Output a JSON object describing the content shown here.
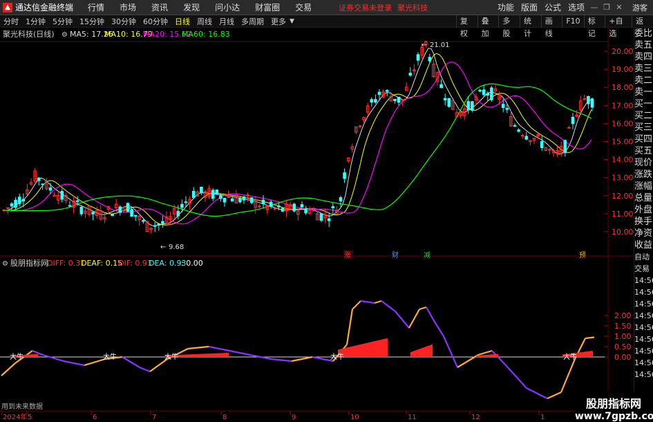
{
  "titlebar": {
    "app_title": "通达信金融终端",
    "menu": [
      "行情",
      "市场",
      "资讯",
      "发现",
      "问小达",
      "财富圈",
      "交易"
    ],
    "login_status": "证券交易未登录",
    "stock_name": "聚光科技",
    "right_menu": [
      "功能",
      "版面",
      "公式",
      "选项"
    ],
    "guest": "游客",
    "colors": {
      "bg": "#2a2a2a",
      "alert": "#e33"
    }
  },
  "toolbar": {
    "periods": [
      "分时",
      "1分钟",
      "5分钟",
      "15分钟",
      "30分钟",
      "60分钟",
      "日线",
      "周线",
      "月线",
      "多周期",
      "更多"
    ],
    "active_period": "日线",
    "right_buttons": [
      "复权",
      "叠加",
      "多股",
      "统计",
      "画线",
      "F10",
      "标记",
      "+自选",
      "返回"
    ]
  },
  "right_panel": {
    "items": [
      "委比",
      "卖五",
      "卖四",
      "卖三",
      "卖二",
      "卖一",
      "买一",
      "买二",
      "买三",
      "买四",
      "买五",
      "现价",
      "涨跌",
      "涨幅",
      "总量",
      "外盘",
      "换手",
      "净资",
      "收益",
      "自动",
      "交易",
      "14:56",
      "14:56",
      "14:56",
      "14:56",
      "14:56",
      "14:56",
      "14:56",
      "14:56",
      "14:56"
    ]
  },
  "price_panel": {
    "legend_title": "聚光科技(日线)",
    "ma_labels": [
      {
        "text": "MA5: 17.26",
        "color": "#dddddd"
      },
      {
        "text": "MA10: 16.79",
        "color": "#ffff00"
      },
      {
        "text": "MA20: 15.62",
        "color": "#ff00ff"
      },
      {
        "text": "MA60: 16.83",
        "color": "#00ff00"
      }
    ],
    "axis_ticks": [
      "20.00",
      "19.00",
      "18.00",
      "17.00",
      "16.00",
      "15.00",
      "14.00",
      "13.00",
      "12.00",
      "11.00",
      "10.00"
    ],
    "high_label": "21.01",
    "low_label": "9.68",
    "markers": [
      {
        "text": "涨",
        "color": "#ff3333"
      },
      {
        "text": "财",
        "color": "#3399ff"
      },
      {
        "text": "减",
        "color": "#33cc33"
      },
      {
        "text": "预",
        "color": "#ffaa00"
      }
    ],
    "colors": {
      "up": "#ff3333",
      "down": "#33ffff",
      "ma5": "#dddddd",
      "ma10": "#ffff00",
      "ma20": "#ff00ff",
      "ma60": "#00ff00"
    }
  },
  "indicator_panel": {
    "title": "股朋指标网",
    "labels": [
      {
        "text": "DIFF: 0.31",
        "color": "#ff3333"
      },
      {
        "text": "DEAF: 0.15",
        "color": "#ffff00"
      },
      {
        "text": "DIF: 0.93",
        "color": "#ff3333"
      },
      {
        "text": "DEA: 0.93",
        "color": "#33ffff"
      },
      {
        "text": ": 0.00",
        "color": "#ffffff"
      }
    ],
    "axis_ticks": [
      "2.00",
      "1.50",
      "1.00",
      "0.50",
      "0.00"
    ],
    "buy_signals": [
      "大牛",
      "大牛",
      "大牛",
      "大牛",
      "大牛"
    ],
    "footer_note": "用到未来数据",
    "colors": {
      "up_line": "#ffaa33",
      "down_line": "#8833ff",
      "bar": "#ff2222"
    }
  },
  "time_axis": {
    "labels": [
      "2024年",
      "5",
      "6",
      "7",
      "8",
      "9",
      "10",
      "11",
      "12",
      "1"
    ]
  },
  "watermark": {
    "title": "股朋指标网",
    "url": "www.7gpzb.com"
  }
}
